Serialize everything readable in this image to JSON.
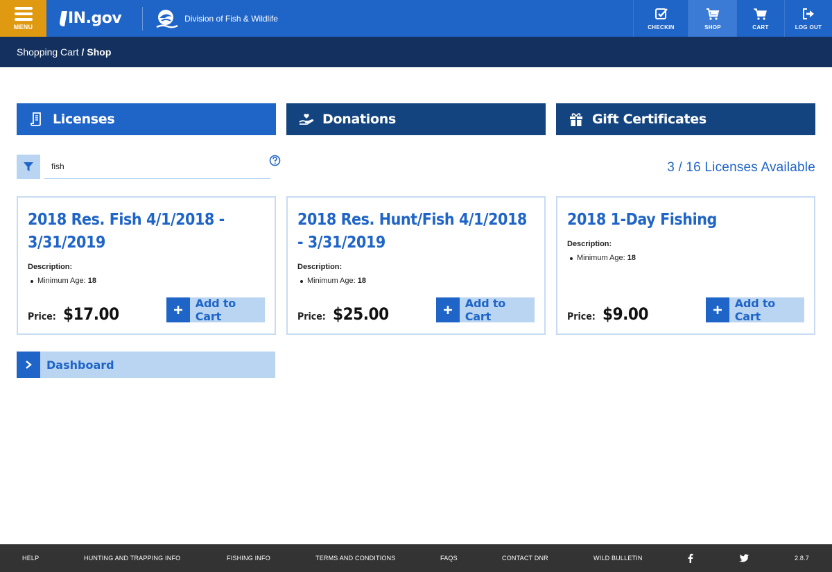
{
  "header": {
    "menu_label": "MENU",
    "brand": "IN.gov",
    "division": "Division of Fish & Wildlife",
    "nav": [
      {
        "label": "CHECKIN",
        "icon": "checkin-icon"
      },
      {
        "label": "SHOP",
        "icon": "shop-cart-icon"
      },
      {
        "label": "CART",
        "icon": "cart-icon"
      },
      {
        "label": "LOG OUT",
        "icon": "logout-icon"
      }
    ],
    "accent": "#1f64c7",
    "menu_color": "#df9a12"
  },
  "breadcrumb": {
    "parent": "Shopping Cart",
    "separator": "/",
    "current": "Shop"
  },
  "tabs": [
    {
      "label": "Licenses",
      "icon": "license-icon"
    },
    {
      "label": "Donations",
      "icon": "donation-hand-icon"
    },
    {
      "label": "Gift Certificates",
      "icon": "gift-icon"
    }
  ],
  "search": {
    "value": "fish",
    "placeholder": ""
  },
  "availability": "3 / 16 Licenses Available",
  "cards": [
    {
      "title": "2018 Res. Fish 4/1/2018 - 3/31/2019",
      "desc_label": "Description:",
      "bullet_label": "Minimum Age:",
      "bullet_value": "18",
      "price_label": "Price:",
      "price": "$17.00",
      "button": "Add to Cart"
    },
    {
      "title": "2018 Res. Hunt/Fish 4/1/2018 - 3/31/2019",
      "desc_label": "Description:",
      "bullet_label": "Minimum Age:",
      "bullet_value": "18",
      "price_label": "Price:",
      "price": "$25.00",
      "button": "Add to Cart"
    },
    {
      "title": "2018 1-Day Fishing",
      "desc_label": "Description:",
      "bullet_label": "Minimum Age:",
      "bullet_value": "18",
      "price_label": "Price:",
      "price": "$9.00",
      "button": "Add to Cart"
    }
  ],
  "dashboard_label": "Dashboard",
  "footer": {
    "links": [
      "HELP",
      "HUNTING AND TRAPPING INFO",
      "FISHING INFO",
      "TERMS AND CONDITIONS",
      "FAQS",
      "CONTACT DNR",
      "WILD BULLETIN"
    ],
    "version": "2.8.7"
  }
}
